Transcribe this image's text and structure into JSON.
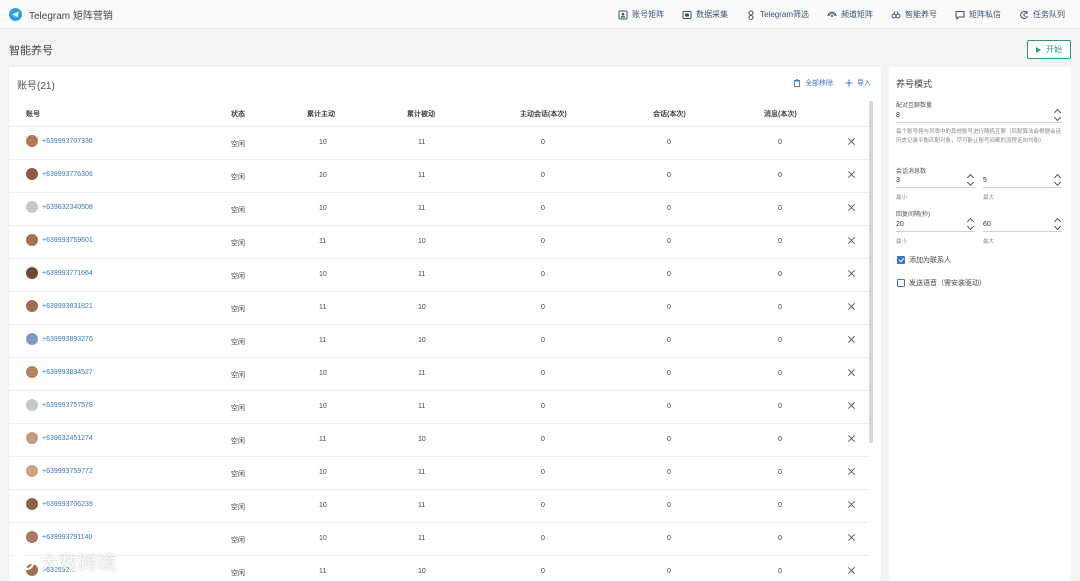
{
  "app": {
    "title": "Telegram 矩阵营销"
  },
  "nav": [
    {
      "label": "账号矩阵",
      "icon": "account-matrix-icon"
    },
    {
      "label": "数据采集",
      "icon": "data-collect-icon"
    },
    {
      "label": "Telegram筛选",
      "icon": "filter-icon"
    },
    {
      "label": "频道矩阵",
      "icon": "channel-icon"
    },
    {
      "label": "智能养号",
      "icon": "nurture-icon"
    },
    {
      "label": "矩阵私信",
      "icon": "message-icon"
    },
    {
      "label": "任务队列",
      "icon": "queue-icon"
    }
  ],
  "page": {
    "title": "智能养号",
    "start_label": "开始"
  },
  "accounts": {
    "title": "账号(21)",
    "remove_all_label": "全部移除",
    "import_label": "导入",
    "columns": [
      "账号",
      "状态",
      "累计主动",
      "累计被动",
      "主动会话(本次)",
      "会话(本次)",
      "消息(本次)"
    ],
    "rows": [
      {
        "account": "+639993707336",
        "status": "空闲",
        "active_total": "10",
        "passive_total": "11",
        "active_session": "0",
        "session": "0",
        "messages": "0",
        "avatar": "photo"
      },
      {
        "account": "+639993776306",
        "status": "空闲",
        "active_total": "10",
        "passive_total": "11",
        "active_session": "0",
        "session": "0",
        "messages": "0",
        "avatar": "photo"
      },
      {
        "account": "+639632340508",
        "status": "空闲",
        "active_total": "10",
        "passive_total": "11",
        "active_session": "0",
        "session": "0",
        "messages": "0",
        "avatar": "blank"
      },
      {
        "account": "+639993759601",
        "status": "空闲",
        "active_total": "11",
        "passive_total": "10",
        "active_session": "0",
        "session": "0",
        "messages": "0",
        "avatar": "photo"
      },
      {
        "account": "+639993771664",
        "status": "空闲",
        "active_total": "10",
        "passive_total": "11",
        "active_session": "0",
        "session": "0",
        "messages": "0",
        "avatar": "photo"
      },
      {
        "account": "+639993831821",
        "status": "空闲",
        "active_total": "11",
        "passive_total": "10",
        "active_session": "0",
        "session": "0",
        "messages": "0",
        "avatar": "photo"
      },
      {
        "account": "+639993893276",
        "status": "空闲",
        "active_total": "11",
        "passive_total": "10",
        "active_session": "0",
        "session": "0",
        "messages": "0",
        "avatar": "photo"
      },
      {
        "account": "+639993834527",
        "status": "空闲",
        "active_total": "10",
        "passive_total": "11",
        "active_session": "0",
        "session": "0",
        "messages": "0",
        "avatar": "photo"
      },
      {
        "account": "+639993757578",
        "status": "空闲",
        "active_total": "10",
        "passive_total": "11",
        "active_session": "0",
        "session": "0",
        "messages": "0",
        "avatar": "blank"
      },
      {
        "account": "+639632451274",
        "status": "空闲",
        "active_total": "11",
        "passive_total": "10",
        "active_session": "0",
        "session": "0",
        "messages": "0",
        "avatar": "photo"
      },
      {
        "account": "+639993759772",
        "status": "空闲",
        "active_total": "10",
        "passive_total": "11",
        "active_session": "0",
        "session": "0",
        "messages": "0",
        "avatar": "photo"
      },
      {
        "account": "+639993706239",
        "status": "空闲",
        "active_total": "10",
        "passive_total": "11",
        "active_session": "0",
        "session": "0",
        "messages": "0",
        "avatar": "photo"
      },
      {
        "account": "+639993791140",
        "status": "空闲",
        "active_total": "10",
        "passive_total": "11",
        "active_session": "0",
        "session": "0",
        "messages": "0",
        "avatar": "photo"
      },
      {
        "account": "+639993...",
        "status": "空闲",
        "active_total": "11",
        "passive_total": "10",
        "active_session": "0",
        "session": "0",
        "messages": "0",
        "avatar": "photo"
      }
    ]
  },
  "mode": {
    "title": "养号模式",
    "pair_label": "配对互聊数量",
    "pair_value": "8",
    "note": "每个账号将与列表中的其他账号进行随机互聊（匹配算法会根据会话历史记录平衡匹配对象，尽可能让账号间都的流程走向均衡）",
    "msg_count_label": "会话消息数",
    "msg_min": "3",
    "msg_max": "5",
    "min_label": "最小",
    "max_label": "最大",
    "interval_label": "回复间隔(秒)",
    "interval_min": "20",
    "interval_max": "60",
    "add_contact_label": "添加为联系人",
    "add_contact_checked": true,
    "send_voice_label": "发送语音（需安装驱动）",
    "send_voice_checked": false
  },
  "watermark": {
    "text": "大数跨境"
  }
}
